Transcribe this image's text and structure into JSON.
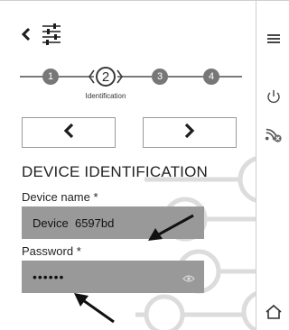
{
  "header": {
    "back_icon": "chevron-left-icon",
    "settings_icon": "sliders-icon"
  },
  "stepper": {
    "steps": [
      {
        "label": "1",
        "state": "inactive"
      },
      {
        "label": "2",
        "state": "active"
      },
      {
        "label": "3",
        "state": "inactive"
      },
      {
        "label": "4",
        "state": "inactive"
      }
    ],
    "active_caption": "Identification"
  },
  "navigation": {
    "prev_icon": "chevron-left-icon",
    "next_icon": "chevron-right-icon"
  },
  "section": {
    "title": "DEVICE IDENTIFICATION"
  },
  "form": {
    "device_name": {
      "label": "Device name *",
      "value": "Device  6597bd"
    },
    "password": {
      "label": "Password *",
      "value": "••••••",
      "reveal_icon": "eye-icon"
    }
  },
  "sidebar": {
    "icons": [
      "menu-icon",
      "power-icon",
      "wifi-off-icon",
      "home-icon"
    ]
  },
  "colors": {
    "input_bg": "#999999",
    "step_inactive": "#777777",
    "text": "#1d1d1d"
  }
}
